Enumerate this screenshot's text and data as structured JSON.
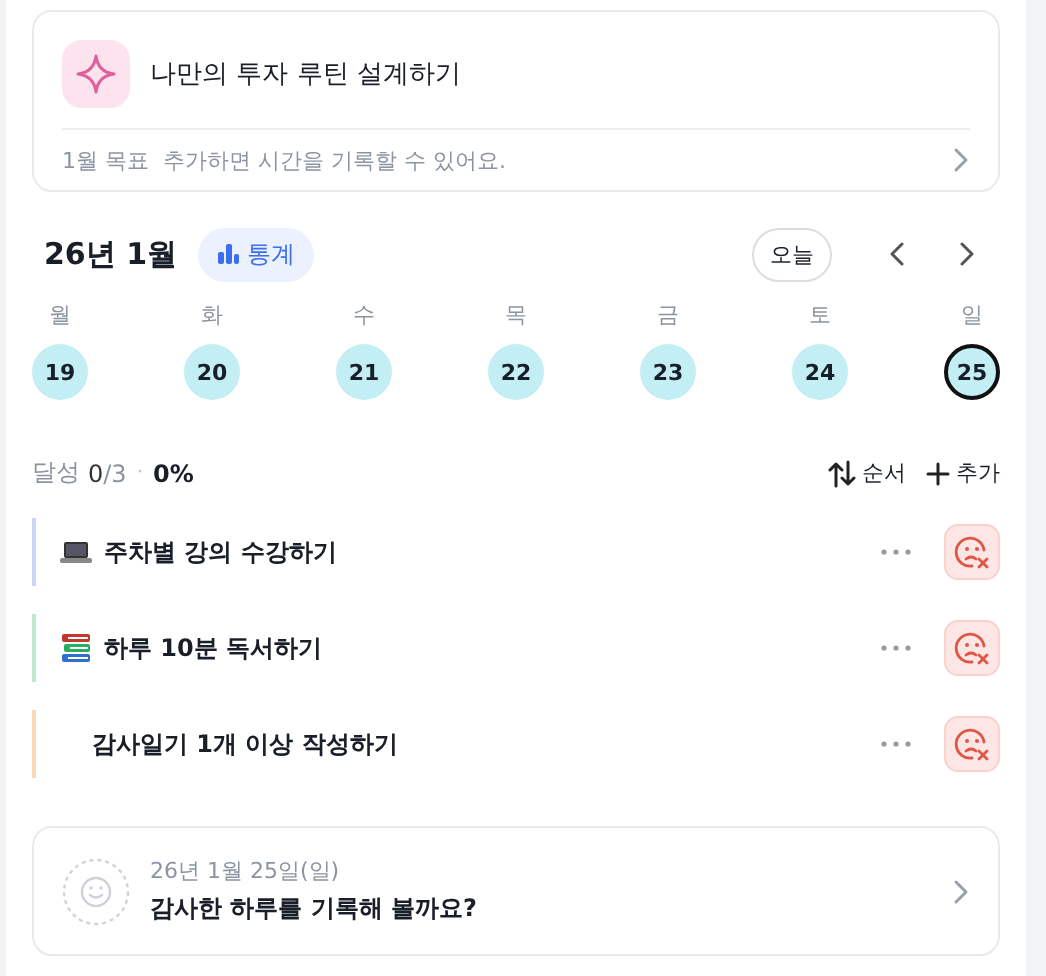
{
  "goal_card": {
    "title": "나만의 투자 루틴 설계하기",
    "tag": "1월 목표",
    "hint": "추가하면 시간을 기록할 수 있어요."
  },
  "calendar": {
    "month": "26년 1월",
    "stats_button": "통계",
    "today_button": "오늘",
    "days": [
      {
        "weekday": "월",
        "date": "19",
        "selected": false
      },
      {
        "weekday": "화",
        "date": "20",
        "selected": false
      },
      {
        "weekday": "수",
        "date": "21",
        "selected": false
      },
      {
        "weekday": "목",
        "date": "22",
        "selected": false
      },
      {
        "weekday": "금",
        "date": "23",
        "selected": false
      },
      {
        "weekday": "토",
        "date": "24",
        "selected": false
      },
      {
        "weekday": "일",
        "date": "25",
        "selected": true
      }
    ]
  },
  "progress": {
    "label": "달성",
    "done": "0",
    "total": "/3",
    "separator": "·",
    "percent": "0%",
    "sort_button": "순서",
    "add_button": "추가"
  },
  "habits": [
    {
      "kind": "laptop",
      "title": "주차별 강의 수강하기",
      "color": "#c9d6f5"
    },
    {
      "kind": "books",
      "title": "하루 10분 독서하기",
      "color": "#bfe8cf"
    },
    {
      "kind": "none",
      "title": "감사일기 1개 이상 작성하기",
      "color": "#fbd9b8"
    }
  ],
  "journal_card": {
    "date": "26년 1월 25일(일)",
    "prompt": "감사한 하루를 기록해 볼까요?"
  }
}
